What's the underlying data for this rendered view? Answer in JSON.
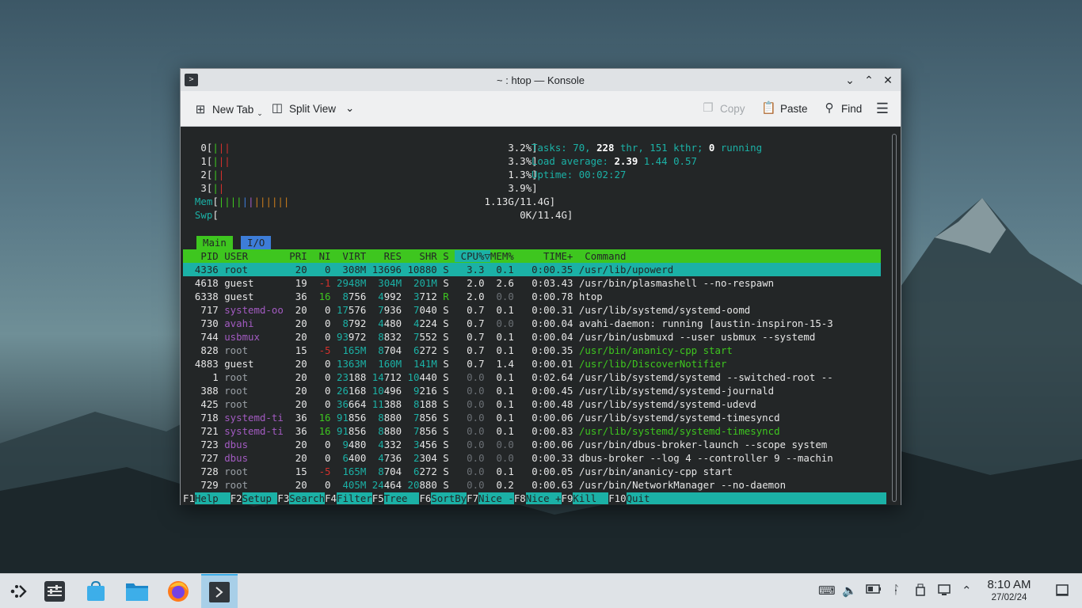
{
  "window": {
    "title": "~ : htop — Konsole",
    "toolbar": {
      "new_tab": "New Tab",
      "split_view": "Split View",
      "copy": "Copy",
      "paste": "Paste",
      "find": "Find"
    }
  },
  "htop": {
    "meters": {
      "cpu0_label": "0",
      "cpu0_value": "3.2%",
      "cpu1_label": "1",
      "cpu1_value": "3.3%",
      "cpu2_label": "2",
      "cpu2_value": "1.3%",
      "cpu3_label": "3",
      "cpu3_value": "3.9%",
      "mem_label": "Mem",
      "mem_value": "1.13G/11.4G",
      "swp_label": "Swp",
      "swp_value": "0K/11.4G"
    },
    "tasks": {
      "label": "Tasks:",
      "procs": "70",
      "thr": "228",
      "thr_label": "thr,",
      "kthr": "151",
      "kthr_label": "kthr;",
      "running": "0",
      "running_label": "running"
    },
    "load": {
      "label": "Load average:",
      "l1": "2.39",
      "l5": "1.44",
      "l15": "0.57"
    },
    "uptime": {
      "label": "Uptime:",
      "value": "00:02:27"
    },
    "tabs": {
      "main": "Main",
      "io": "I/O"
    },
    "columns": [
      "PID",
      "USER",
      "PRI",
      "NI",
      "VIRT",
      "RES",
      "SHR",
      "S",
      "CPU%",
      "MEM%",
      "TIME+",
      "Command"
    ],
    "rows": [
      {
        "pid": "4336",
        "user": "root",
        "pri": "20",
        "ni": "0",
        "virt": "308M",
        "res": "13696",
        "shr": "10880",
        "s": "S",
        "cpu": "3.3",
        "mem": "0.1",
        "time": "0:00.35",
        "cmd": "/usr/lib/upowerd"
      },
      {
        "pid": "4618",
        "user": "guest",
        "pri": "19",
        "ni": "-1",
        "virt": "2948M",
        "res": "304M",
        "shr": "201M",
        "s": "S",
        "cpu": "2.0",
        "mem": "2.6",
        "time": "0:03.43",
        "cmd": "/usr/bin/plasmashell --no-respawn"
      },
      {
        "pid": "6338",
        "user": "guest",
        "pri": "36",
        "ni": "16",
        "virt": "8756",
        "res": "4992",
        "shr": "3712",
        "s": "R",
        "cpu": "2.0",
        "mem": "0.0",
        "time": "0:00.78",
        "cmd": "htop"
      },
      {
        "pid": "717",
        "user": "systemd-oo",
        "pri": "20",
        "ni": "0",
        "virt": "17576",
        "res": "7936",
        "shr": "7040",
        "s": "S",
        "cpu": "0.7",
        "mem": "0.1",
        "time": "0:00.31",
        "cmd": "/usr/lib/systemd/systemd-oomd"
      },
      {
        "pid": "730",
        "user": "avahi",
        "pri": "20",
        "ni": "0",
        "virt": "8792",
        "res": "4480",
        "shr": "4224",
        "s": "S",
        "cpu": "0.7",
        "mem": "0.0",
        "time": "0:00.04",
        "cmd": "avahi-daemon: running [austin-inspiron-15-3"
      },
      {
        "pid": "744",
        "user": "usbmux",
        "pri": "20",
        "ni": "0",
        "virt": "93972",
        "res": "8832",
        "shr": "7552",
        "s": "S",
        "cpu": "0.7",
        "mem": "0.1",
        "time": "0:00.04",
        "cmd": "/usr/bin/usbmuxd --user usbmux --systemd"
      },
      {
        "pid": "828",
        "user": "root",
        "pri": "15",
        "ni": "-5",
        "virt": "165M",
        "res": "8704",
        "shr": "6272",
        "s": "S",
        "cpu": "0.7",
        "mem": "0.1",
        "time": "0:00.35",
        "cmd": "/usr/bin/ananicy-cpp start"
      },
      {
        "pid": "4883",
        "user": "guest",
        "pri": "20",
        "ni": "0",
        "virt": "1363M",
        "res": "160M",
        "shr": "141M",
        "s": "S",
        "cpu": "0.7",
        "mem": "1.4",
        "time": "0:00.01",
        "cmd": "/usr/lib/DiscoverNotifier"
      },
      {
        "pid": "1",
        "user": "root",
        "pri": "20",
        "ni": "0",
        "virt": "23188",
        "res": "14712",
        "shr": "10440",
        "s": "S",
        "cpu": "0.0",
        "mem": "0.1",
        "time": "0:02.64",
        "cmd": "/usr/lib/systemd/systemd --switched-root --"
      },
      {
        "pid": "388",
        "user": "root",
        "pri": "20",
        "ni": "0",
        "virt": "26168",
        "res": "10496",
        "shr": "9216",
        "s": "S",
        "cpu": "0.0",
        "mem": "0.1",
        "time": "0:00.45",
        "cmd": "/usr/lib/systemd/systemd-journald"
      },
      {
        "pid": "425",
        "user": "root",
        "pri": "20",
        "ni": "0",
        "virt": "36664",
        "res": "11388",
        "shr": "8188",
        "s": "S",
        "cpu": "0.0",
        "mem": "0.1",
        "time": "0:00.48",
        "cmd": "/usr/lib/systemd/systemd-udevd"
      },
      {
        "pid": "718",
        "user": "systemd-ti",
        "pri": "36",
        "ni": "16",
        "virt": "91856",
        "res": "8880",
        "shr": "7856",
        "s": "S",
        "cpu": "0.0",
        "mem": "0.1",
        "time": "0:00.06",
        "cmd": "/usr/lib/systemd/systemd-timesyncd"
      },
      {
        "pid": "721",
        "user": "systemd-ti",
        "pri": "36",
        "ni": "16",
        "virt": "91856",
        "res": "8880",
        "shr": "7856",
        "s": "S",
        "cpu": "0.0",
        "mem": "0.1",
        "time": "0:00.83",
        "cmd": "/usr/lib/systemd/systemd-timesyncd"
      },
      {
        "pid": "723",
        "user": "dbus",
        "pri": "20",
        "ni": "0",
        "virt": "9480",
        "res": "4332",
        "shr": "3456",
        "s": "S",
        "cpu": "0.0",
        "mem": "0.0",
        "time": "0:00.06",
        "cmd": "/usr/bin/dbus-broker-launch --scope system"
      },
      {
        "pid": "727",
        "user": "dbus",
        "pri": "20",
        "ni": "0",
        "virt": "6400",
        "res": "4736",
        "shr": "2304",
        "s": "S",
        "cpu": "0.0",
        "mem": "0.0",
        "time": "0:00.33",
        "cmd": "dbus-broker --log 4 --controller 9 --machin"
      },
      {
        "pid": "728",
        "user": "root",
        "pri": "15",
        "ni": "-5",
        "virt": "165M",
        "res": "8704",
        "shr": "6272",
        "s": "S",
        "cpu": "0.0",
        "mem": "0.1",
        "time": "0:00.05",
        "cmd": "/usr/bin/ananicy-cpp start"
      },
      {
        "pid": "729",
        "user": "root",
        "pri": "20",
        "ni": "0",
        "virt": "405M",
        "res": "24464",
        "shr": "20880",
        "s": "S",
        "cpu": "0.0",
        "mem": "0.2",
        "time": "0:00.63",
        "cmd": "/usr/bin/NetworkManager --no-daemon"
      }
    ],
    "fkeys": [
      {
        "key": "F1",
        "label": "Help  "
      },
      {
        "key": "F2",
        "label": "Setup "
      },
      {
        "key": "F3",
        "label": "Search"
      },
      {
        "key": "F4",
        "label": "Filter"
      },
      {
        "key": "F5",
        "label": "Tree  "
      },
      {
        "key": "F6",
        "label": "SortBy"
      },
      {
        "key": "F7",
        "label": "Nice -"
      },
      {
        "key": "F8",
        "label": "Nice +"
      },
      {
        "key": "F9",
        "label": "Kill  "
      },
      {
        "key": "F10",
        "label": "Quit"
      }
    ]
  },
  "taskbar": {
    "clock_time": "8:10 AM",
    "clock_date": "27/02/24"
  }
}
